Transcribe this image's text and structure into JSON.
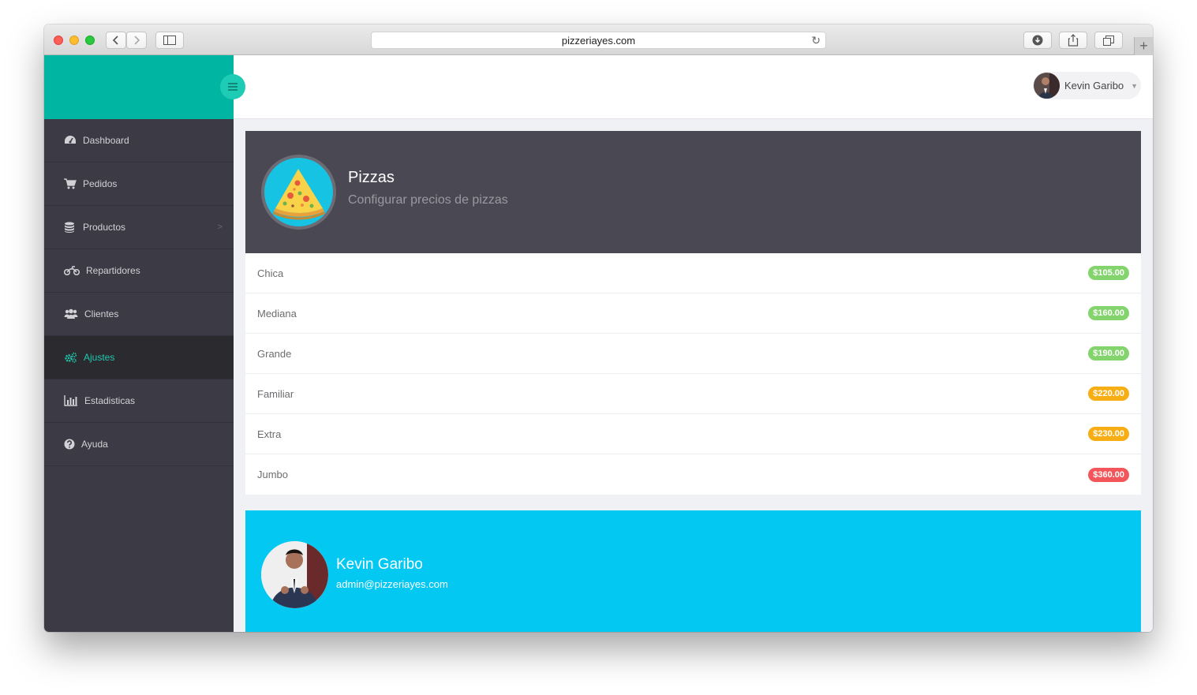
{
  "browser": {
    "url": "pizzeriayes.com",
    "traffic_lights": [
      "#fc5f57",
      "#fdbc2e",
      "#28c840"
    ]
  },
  "sidebar": {
    "brand_color": "#00b5a2",
    "items": [
      {
        "label": "Dashboard",
        "icon": "dashboard-icon"
      },
      {
        "label": "Pedidos",
        "icon": "cart-icon"
      },
      {
        "label": "Productos",
        "icon": "database-icon",
        "has_submenu": true
      },
      {
        "label": "Repartidores",
        "icon": "motorcycle-icon"
      },
      {
        "label": "Clientes",
        "icon": "users-icon"
      },
      {
        "label": "Ajustes",
        "icon": "cogs-icon",
        "active": true
      },
      {
        "label": "Estadisticas",
        "icon": "bar-chart-icon"
      },
      {
        "label": "Ayuda",
        "icon": "question-icon"
      }
    ]
  },
  "header": {
    "user_name": "Kevin Garibo"
  },
  "pizza_card": {
    "title": "Pizzas",
    "subtitle": "Configurar precios de pizzas",
    "icon": "pizza-slice-icon",
    "rows": [
      {
        "size": "Chica",
        "price": "$105.00",
        "color": "#84d46e"
      },
      {
        "size": "Mediana",
        "price": "$160.00",
        "color": "#84d46e"
      },
      {
        "size": "Grande",
        "price": "$190.00",
        "color": "#84d46e"
      },
      {
        "size": "Familiar",
        "price": "$220.00",
        "color": "#f7ad14"
      },
      {
        "size": "Extra",
        "price": "$230.00",
        "color": "#f7ad14"
      },
      {
        "size": "Jumbo",
        "price": "$360.00",
        "color": "#f2565a"
      }
    ]
  },
  "profile": {
    "name": "Kevin Garibo",
    "email": "admin@pizzeriayes.com",
    "bg_color": "#03c8f2"
  }
}
